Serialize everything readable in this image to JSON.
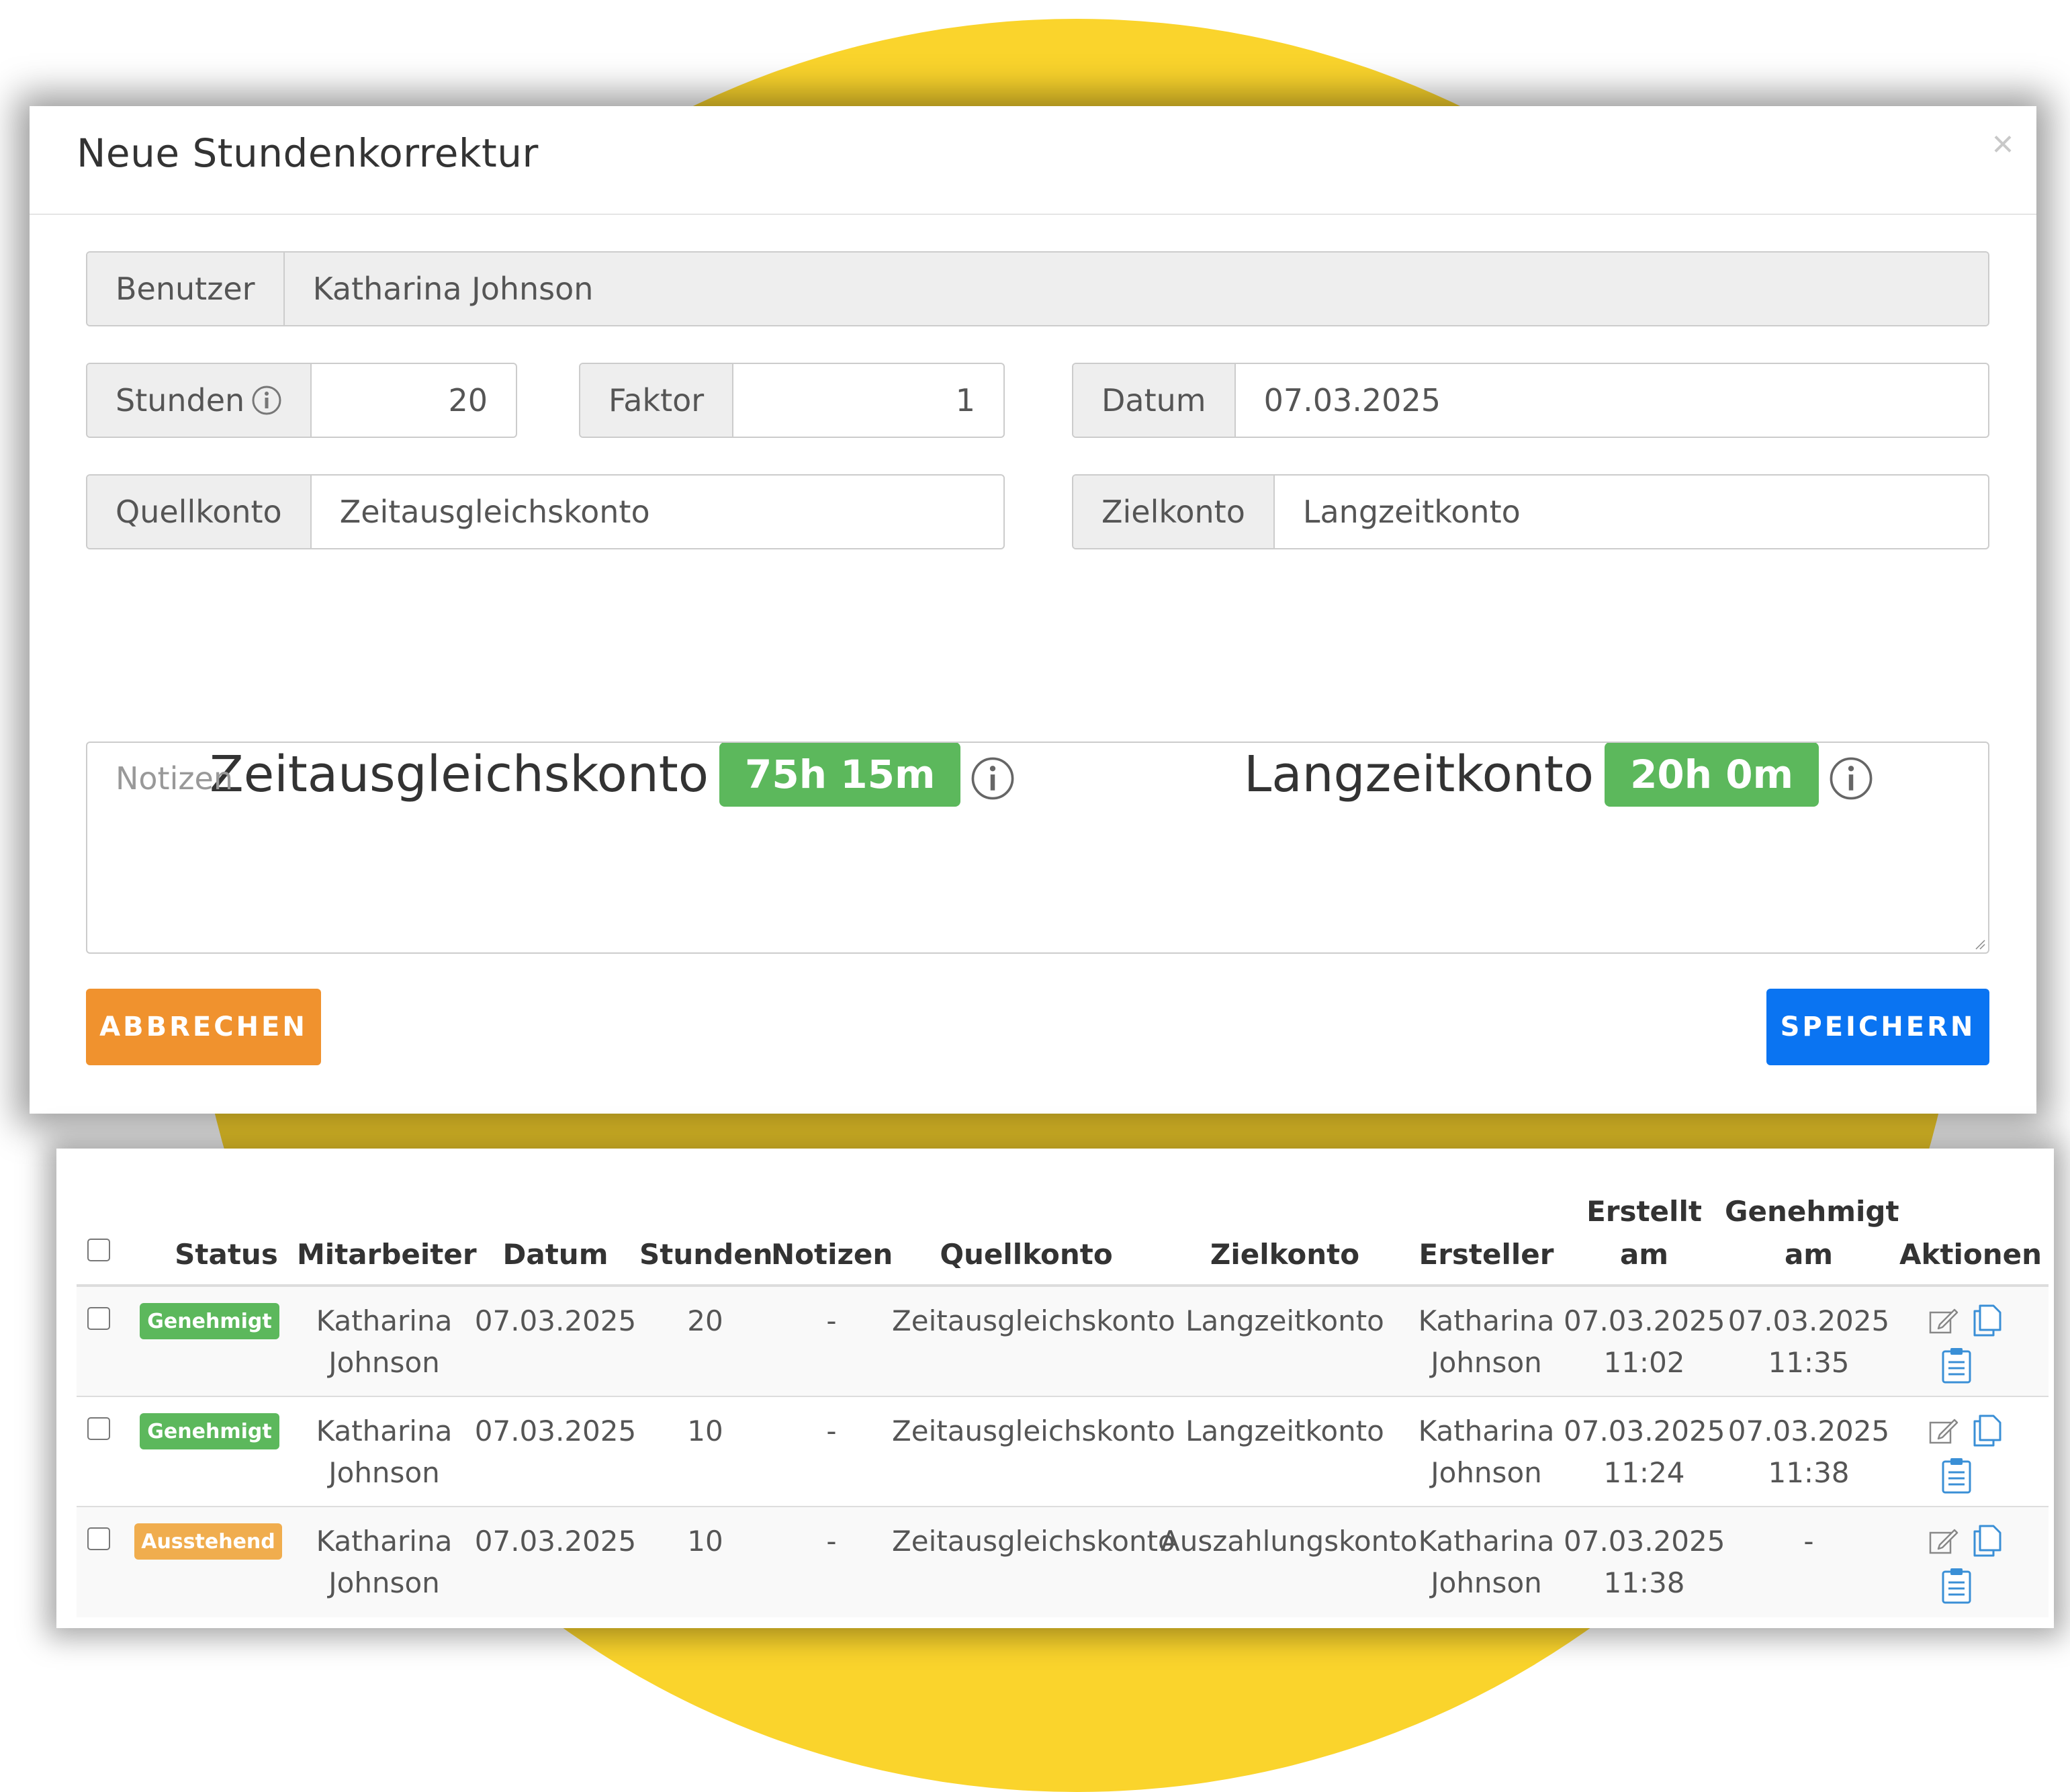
{
  "colors": {
    "circle": "#fad42c",
    "badge_success": "#5cb85c",
    "badge_warning": "#f0ad4e",
    "button_cancel": "#f0922e",
    "button_save": "#0a74f2",
    "action_icon_blue": "#3a8fd6"
  },
  "modal": {
    "title": "Neue Stundenkorrektur",
    "close_symbol": "×",
    "close_icon": "close-icon",
    "benutzer": {
      "label": "Benutzer",
      "value": "Katharina Johnson"
    },
    "stunden": {
      "label": "Stunden",
      "value": "20",
      "icon": "info-icon"
    },
    "faktor": {
      "label": "Faktor",
      "value": "1"
    },
    "datum": {
      "label": "Datum",
      "value": "07.03.2025"
    },
    "quellkonto": {
      "label": "Quellkonto",
      "value": "Zeitausgleichskonto"
    },
    "zielkonto": {
      "label": "Zielkonto",
      "value": "Langzeitkonto"
    },
    "balances": [
      {
        "name": "Zeitausgleichskonto",
        "amount": "75h 15m",
        "icon": "info-icon"
      },
      {
        "name": "Langzeitkonto",
        "amount": "20h 0m",
        "icon": "info-icon"
      }
    ],
    "notes_placeholder": "Notizen",
    "cancel_label": "ABBRECHEN",
    "save_label": "SPEICHERN"
  },
  "table": {
    "headers": {
      "status": "Status",
      "mitarbeiter": "Mitarbeiter",
      "datum": "Datum",
      "stunden": "Stunden",
      "notizen": "Notizen",
      "quellkonto": "Quellkonto",
      "zielkonto": "Zielkonto",
      "ersteller": "Ersteller",
      "erstellt_1": "Erstellt",
      "erstellt_2": "am",
      "genehmigt_1": "Genehmigt",
      "genehmigt_2": "am",
      "aktionen": "Aktionen"
    },
    "action_icons": [
      "edit-icon",
      "copy-icon",
      "clipboard-icon"
    ],
    "rows": [
      {
        "status": "Genehmigt",
        "status_color": "#5cb85c",
        "mitarbeiter_1": "Katharina",
        "mitarbeiter_2": "Johnson",
        "datum": "07.03.2025",
        "stunden": "20",
        "notizen": "-",
        "quellkonto": "Zeitausgleichskonto",
        "zielkonto": "Langzeitkonto",
        "ersteller_1": "Katharina",
        "ersteller_2": "Johnson",
        "erstellt_1": "07.03.2025",
        "erstellt_2": "11:02",
        "genehmigt_1": "07.03.2025",
        "genehmigt_2": "11:35"
      },
      {
        "status": "Genehmigt",
        "status_color": "#5cb85c",
        "mitarbeiter_1": "Katharina",
        "mitarbeiter_2": "Johnson",
        "datum": "07.03.2025",
        "stunden": "10",
        "notizen": "-",
        "quellkonto": "Zeitausgleichskonto",
        "zielkonto": "Langzeitkonto",
        "ersteller_1": "Katharina",
        "ersteller_2": "Johnson",
        "erstellt_1": "07.03.2025",
        "erstellt_2": "11:24",
        "genehmigt_1": "07.03.2025",
        "genehmigt_2": "11:38"
      },
      {
        "status": "Ausstehend",
        "status_color": "#f0ad4e",
        "mitarbeiter_1": "Katharina",
        "mitarbeiter_2": "Johnson",
        "datum": "07.03.2025",
        "stunden": "10",
        "notizen": "-",
        "quellkonto": "Zeitausgleichskonto",
        "zielkonto": "Auszahlungskonto",
        "ersteller_1": "Katharina",
        "ersteller_2": "Johnson",
        "erstellt_1": "07.03.2025",
        "erstellt_2": "11:38",
        "genehmigt_1": "-",
        "genehmigt_2": ""
      }
    ]
  }
}
